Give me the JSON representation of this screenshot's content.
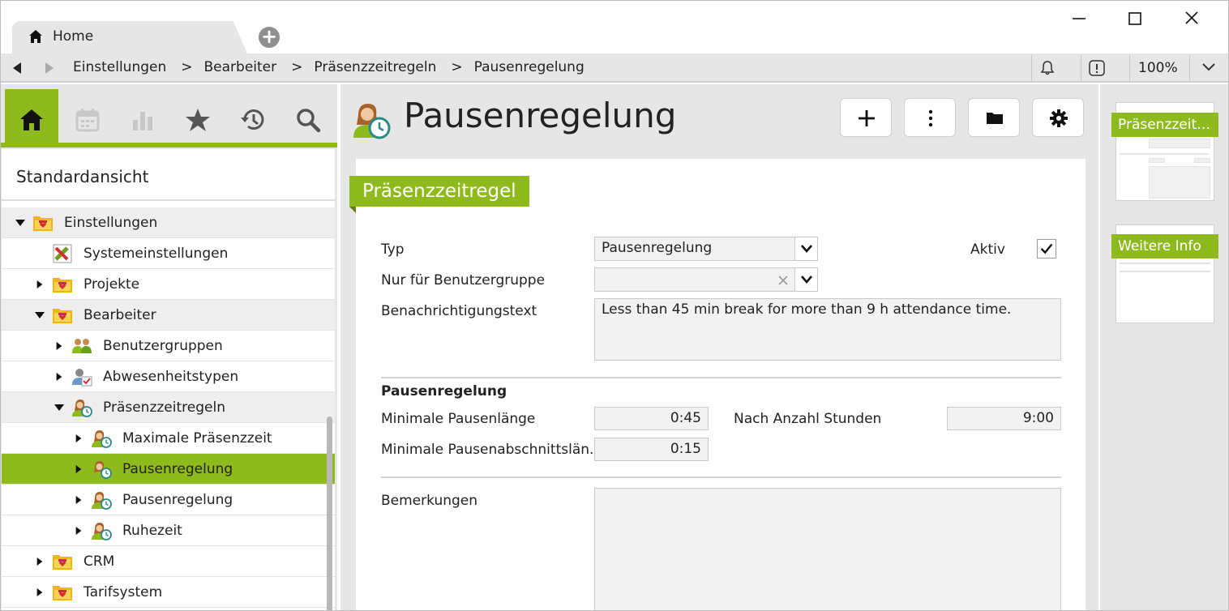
{
  "tabs": [
    {
      "label": "Home",
      "icon": "home-icon"
    }
  ],
  "window_controls": {
    "minimize": "minimize-icon",
    "maximize": "maximize-icon",
    "close": "close-icon"
  },
  "breadcrumb": [
    "Einstellungen",
    "Bearbeiter",
    "Präsenzzeitregeln",
    "Pausenregelung"
  ],
  "breadcrumb_separator": ">",
  "zoom": "100%",
  "sidebar": {
    "view_title": "Standardansicht",
    "tabs": [
      "home-icon",
      "calendar-icon",
      "bar-chart-icon",
      "star-icon",
      "history-icon",
      "search-icon"
    ],
    "tree": [
      {
        "label": "Einstellungen",
        "level": 0,
        "state": "expanded",
        "icon": "folder-heart-icon"
      },
      {
        "label": "Systemeinstellungen",
        "level": 1,
        "state": "leaf",
        "icon": "tools-icon"
      },
      {
        "label": "Projekte",
        "level": 1,
        "state": "collapsed",
        "icon": "folder-heart-icon"
      },
      {
        "label": "Bearbeiter",
        "level": 1,
        "state": "expanded",
        "icon": "folder-heart-icon"
      },
      {
        "label": "Benutzergruppen",
        "level": 2,
        "state": "collapsed",
        "icon": "users-icon"
      },
      {
        "label": "Abwesenheitstypen",
        "level": 2,
        "state": "collapsed",
        "icon": "user-check-icon"
      },
      {
        "label": "Präsenzzeitregeln",
        "level": 2,
        "state": "expanded",
        "icon": "user-clock-icon"
      },
      {
        "label": "Maximale Präsenzzeit",
        "level": 3,
        "state": "collapsed",
        "icon": "user-clock-icon"
      },
      {
        "label": "Pausenregelung",
        "level": 3,
        "state": "collapsed",
        "icon": "user-clock-icon",
        "selected": true
      },
      {
        "label": "Pausenregelung",
        "level": 3,
        "state": "collapsed",
        "icon": "user-clock-icon"
      },
      {
        "label": "Ruhezeit",
        "level": 3,
        "state": "collapsed",
        "icon": "user-clock-icon"
      },
      {
        "label": "CRM",
        "level": 1,
        "state": "collapsed",
        "icon": "folder-heart-icon"
      },
      {
        "label": "Tarifsystem",
        "level": 1,
        "state": "collapsed",
        "icon": "folder-heart-icon"
      }
    ]
  },
  "main": {
    "title": "Pausenregelung",
    "toolbar": [
      "add-icon",
      "more-vertical-icon",
      "folder-icon",
      "gear-icon"
    ],
    "section": "Präsenzzeitregel",
    "form": {
      "typ_label": "Typ",
      "typ_value": "Pausenregelung",
      "aktiv_label": "Aktiv",
      "aktiv_checked": true,
      "gruppe_label": "Nur für Benutzergruppe",
      "gruppe_value": "",
      "text_label": "Benachrichtigungstext",
      "text_value": "Less than 45 min break for more than 9 h attendance time.",
      "sub_heading": "Pausenregelung",
      "min_pause_label": "Minimale Pausenlänge",
      "min_pause_value": "0:45",
      "nach_stunden_label": "Nach Anzahl Stunden",
      "nach_stunden_value": "9:00",
      "min_abschnitt_label": "Minimale Pausenabschnittslän...",
      "min_abschnitt_value": "0:15",
      "bemerkungen_label": "Bemerkungen",
      "bemerkungen_value": ""
    }
  },
  "preview": [
    {
      "label": "Präsenzzeitre..."
    },
    {
      "label": "Weitere Info"
    }
  ],
  "colors": {
    "accent": "#8fba1e",
    "accent_dark": "#5f7f12",
    "chrome": "#e6e6e6",
    "field": "#f2f2f2"
  }
}
